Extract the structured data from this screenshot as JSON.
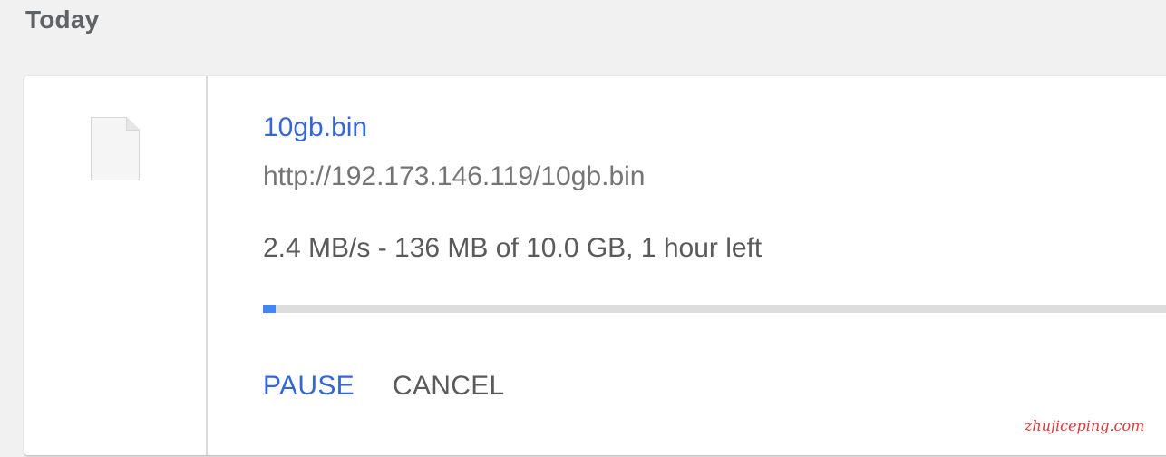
{
  "section": {
    "date_label": "Today"
  },
  "download": {
    "file_icon": "blank-file-icon",
    "file_name": "10gb.bin",
    "url": "http://192.173.146.119/10gb.bin",
    "status": "2.4 MB/s - 136 MB of 10.0 GB, 1 hour left",
    "progress_fraction": 0.0136,
    "progress_color": "#4285f4",
    "actions": {
      "pause_label": "PAUSE",
      "cancel_label": "CANCEL"
    }
  },
  "watermark": {
    "text": "zhujiceping.com"
  },
  "colors": {
    "link": "#3367d6",
    "background": "#f1f1f1",
    "card": "#ffffff"
  }
}
